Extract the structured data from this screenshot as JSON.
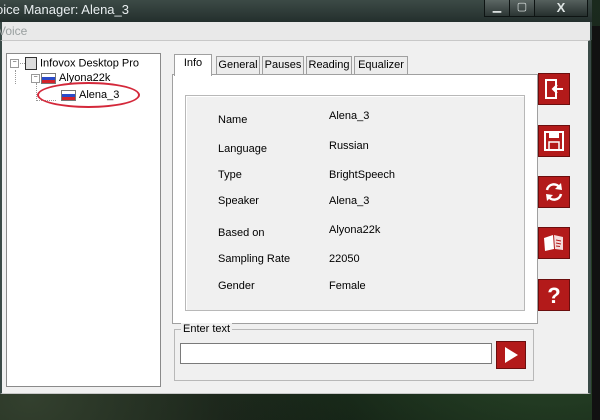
{
  "window": {
    "title": "oice Manager: Alena_3",
    "menu_label": "Voice"
  },
  "tree": {
    "root": "Infovox Desktop Pro",
    "voice_group": "Alyona22k",
    "voice": "Alena_3"
  },
  "tabs": [
    "Info",
    "General",
    "Pauses",
    "Reading",
    "Equalizer"
  ],
  "info": [
    {
      "key": "Name",
      "value": "Alena_3"
    },
    {
      "key": "Language",
      "value": "Russian"
    },
    {
      "key": "Type",
      "value": "BrightSpeech"
    },
    {
      "key": "Speaker",
      "value": "Alena_3"
    },
    {
      "key": "Based on",
      "value": "Alyona22k"
    },
    {
      "key": "Sampling Rate",
      "value": "22050"
    },
    {
      "key": "Gender",
      "value": "Female"
    }
  ],
  "enter_text": {
    "legend": "Enter text",
    "value": ""
  },
  "side_buttons": [
    "exit-icon",
    "save-icon",
    "refresh-icon",
    "read-icon",
    "help-icon"
  ],
  "colors": {
    "button_red": "#b31a1a",
    "highlight_circle": "#d4283a"
  }
}
